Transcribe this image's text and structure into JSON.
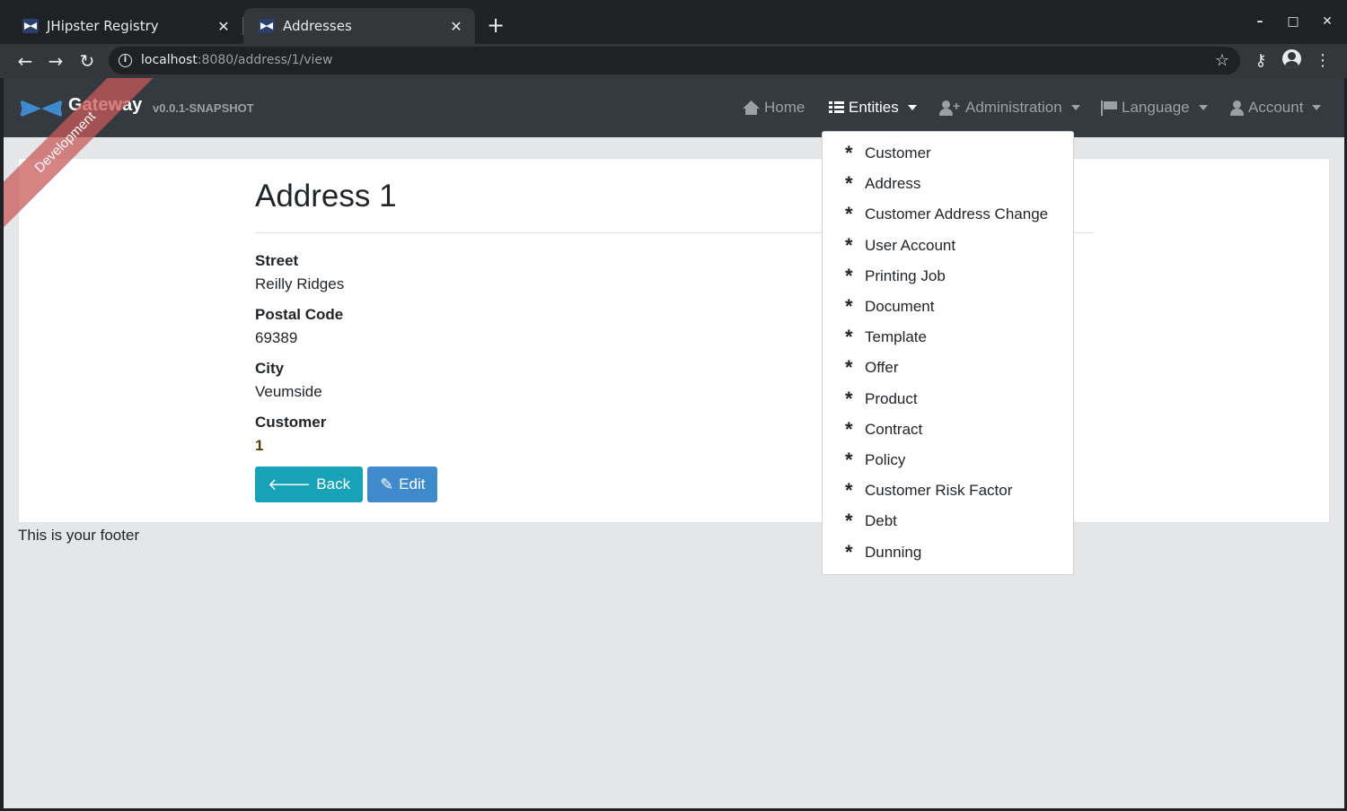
{
  "browser": {
    "tabs": [
      {
        "title": "JHipster Registry",
        "active": false
      },
      {
        "title": "Addresses",
        "active": true
      }
    ],
    "new_tab": "+",
    "window_controls": {
      "minimize": "–",
      "maximize": "□",
      "close": "✕"
    },
    "nav": {
      "back": "←",
      "forward": "→",
      "reload": "↻"
    },
    "url_host": "localhost",
    "url_rest": ":8080/address/1/view",
    "bookmark_icon": "☆",
    "key_icon": "⚷",
    "menu_icon": "⋮"
  },
  "navbar": {
    "brand_title": "Gateway",
    "brand_version": "v0.0.1-SNAPSHOT",
    "ribbon": "Development",
    "items": [
      {
        "label": "Home",
        "icon": "home-icon"
      },
      {
        "label": "Entities",
        "icon": "list-icon"
      },
      {
        "label": "Administration",
        "icon": "user-plus-icon"
      },
      {
        "label": "Language",
        "icon": "flag-icon"
      },
      {
        "label": "Account",
        "icon": "user-icon"
      }
    ]
  },
  "entities_menu": {
    "items": [
      "Customer",
      "Address",
      "Customer Address Change",
      "User Account",
      "Printing Job",
      "Document",
      "Template",
      "Offer",
      "Product",
      "Contract",
      "Policy",
      "Customer Risk Factor",
      "Debt",
      "Dunning"
    ]
  },
  "detail": {
    "title": "Address 1",
    "fields": [
      {
        "label": "Street",
        "value": "Reilly Ridges"
      },
      {
        "label": "Postal Code",
        "value": "69389"
      },
      {
        "label": "City",
        "value": "Veumside"
      },
      {
        "label": "Customer",
        "value": "1"
      }
    ],
    "back_label": "Back",
    "edit_label": "Edit"
  },
  "footer": "This is your footer",
  "colors": {
    "navbar_bg": "#343a40",
    "back_button": "#17a2b8",
    "edit_button": "#3e8acc",
    "ribbon": "#c85a5a",
    "customer_link": "#533f03"
  }
}
